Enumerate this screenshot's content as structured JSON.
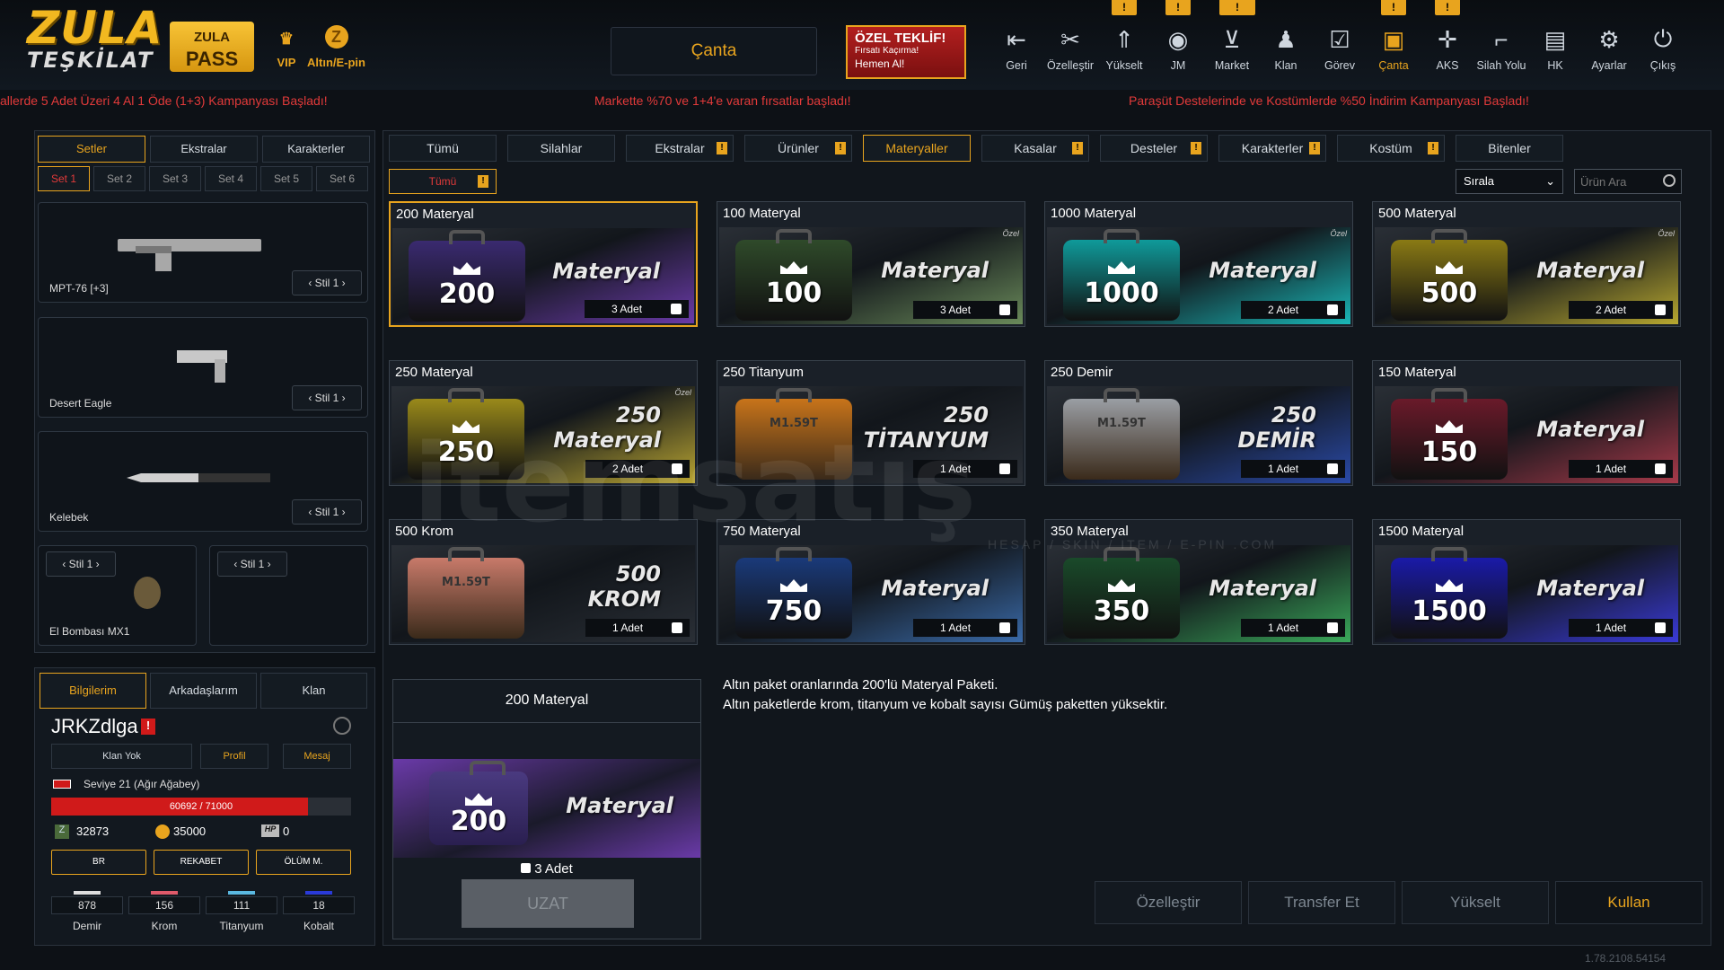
{
  "logo": {
    "line1": "ZULA",
    "line2": "TEŞKİLAT"
  },
  "pass": {
    "line1": "ZULA",
    "line2": "PASS"
  },
  "vip_label": "VIP",
  "gold_label": "Altın/E-pin",
  "canta_title": "Çanta",
  "offer": {
    "title": "ÖZEL TEKLİF!",
    "sub": "Fırsatı Kaçırma!",
    "cta": "Hemen Al!"
  },
  "nav": [
    {
      "label": "Geri",
      "icon": "back-icon"
    },
    {
      "label": "Özelleştir",
      "icon": "tools-icon"
    },
    {
      "label": "Yükselt",
      "icon": "upgrade-icon"
    },
    {
      "label": "JM",
      "icon": "coins-icon"
    },
    {
      "label": "Market",
      "icon": "cart-icon"
    },
    {
      "label": "Klan",
      "icon": "clan-icon"
    },
    {
      "label": "Görev",
      "icon": "clipboard-icon"
    },
    {
      "label": "Çanta",
      "icon": "bag-icon"
    },
    {
      "label": "AKS",
      "icon": "crosshair-icon"
    },
    {
      "label": "Silah Yolu",
      "icon": "gun-icon"
    },
    {
      "label": "HK",
      "icon": "wallet-icon"
    },
    {
      "label": "Ayarlar",
      "icon": "gear-icon"
    },
    {
      "label": "Çıkış",
      "icon": "power-icon"
    }
  ],
  "badges": {
    "mark": "!"
  },
  "ticker": [
    "allerde 5 Adet Üzeri 4 Al 1 Öde (1+3) Kampanyası Başladı!",
    "Markette %70 ve 1+4'e varan fırsatlar başladı!",
    "Paraşüt Destelerinde ve Kostümlerde %50 İndirim Kampanyası Başladı!"
  ],
  "left": {
    "tabs": [
      "Setler",
      "Ekstralar",
      "Karakterler"
    ],
    "sets": [
      "Set 1",
      "Set 2",
      "Set 3",
      "Set 4",
      "Set 5",
      "Set 6"
    ],
    "weapons": [
      "MPT-76 [+3]",
      "Desert Eagle",
      "Kelebek",
      "El Bombası MX1"
    ],
    "stil": "‹  Stil 1  ›"
  },
  "profile": {
    "tabs": [
      "Bilgilerim",
      "Arkadaşlarım",
      "Klan"
    ],
    "name": "JRKZdlga",
    "clan": "Klan Yok",
    "profil": "Profil",
    "mesaj": "Mesaj",
    "level": "Seviye 21 (Ağır Ağabey)",
    "xp": "60692 / 71000",
    "xp_progress": 0.855,
    "zula_points": "32873",
    "gold": "35000",
    "hp": "0",
    "modes": [
      "BR",
      "REKABET",
      "ÖLÜM M."
    ],
    "resources": [
      {
        "name": "Demir",
        "value": "878",
        "color": "#dddddd"
      },
      {
        "name": "Krom",
        "value": "156",
        "color": "#e05a6a"
      },
      {
        "name": "Titanyum",
        "value": "111",
        "color": "#5ab8e0"
      },
      {
        "name": "Kobalt",
        "value": "18",
        "color": "#2a3ad8"
      }
    ]
  },
  "cats": [
    "Tümü",
    "Silahlar",
    "Ekstralar",
    "Ürünler",
    "Materyaller",
    "Kasalar",
    "Desteler",
    "Karakterler",
    "Kostüm",
    "Bitenler"
  ],
  "subfilter": "Tümü",
  "sort_label": "Sırala",
  "search_placeholder": "Ürün Ara",
  "items": [
    {
      "title": "200 Materyal",
      "num": "200",
      "label": "Materyal",
      "count": "3 Adet",
      "color": "#3a2a70",
      "bg": "#6a3aa8",
      "ozel": ""
    },
    {
      "title": "100 Materyal",
      "num": "100",
      "label": "Materyal",
      "count": "3 Adet",
      "color": "#2f4a2a",
      "bg": "#6a8a5a",
      "ozel": "Özel"
    },
    {
      "title": "1000 Materyal",
      "num": "1000",
      "label": "Materyal",
      "count": "2 Adet",
      "color": "#0f9a9a",
      "bg": "#1ab8b8",
      "ozel": "Özel"
    },
    {
      "title": "500 Materyal",
      "num": "500",
      "label": "Materyal",
      "count": "2 Adet",
      "color": "#8a7a14",
      "bg": "#b8a830",
      "ozel": "Özel"
    },
    {
      "title": "250 Materyal",
      "num": "250",
      "label": "250\nMateryal",
      "count": "2 Adet",
      "color": "#9a8a1a",
      "bg": "#b8a432",
      "ozel": "Özel"
    },
    {
      "title": "250 Titanyum",
      "num": "M1.59T",
      "label": "250\nTİTANYUM",
      "count": "1 Adet",
      "color": "#c8741a",
      "bg": "#2a2f36",
      "ozel": ""
    },
    {
      "title": "250 Demir",
      "num": "M1.59T",
      "label": "250\nDEMİR",
      "count": "1 Adet",
      "color": "#9a9ea4",
      "bg": "#2a4aa8",
      "ozel": ""
    },
    {
      "title": "150 Materyal",
      "num": "150",
      "label": "Materyal",
      "count": "1 Adet",
      "color": "#6a1a2a",
      "bg": "#a83a4a",
      "ozel": ""
    },
    {
      "title": "500 Krom",
      "num": "M1.59T",
      "label": "500\nKROM",
      "count": "1 Adet",
      "color": "#c87a6a",
      "bg": "#2a2f36",
      "ozel": ""
    },
    {
      "title": "750 Materyal",
      "num": "750",
      "label": "Materyal",
      "count": "1 Adet",
      "color": "#1a3a7a",
      "bg": "#3a6aa8",
      "ozel": ""
    },
    {
      "title": "350 Materyal",
      "num": "350",
      "label": "Materyal",
      "count": "1 Adet",
      "color": "#1a4a2a",
      "bg": "#3aa85a",
      "ozel": ""
    },
    {
      "title": "1500 Materyal",
      "num": "1500",
      "label": "Materyal",
      "count": "1 Adet",
      "color": "#1a1aa8",
      "bg": "#3a3ad8",
      "ozel": ""
    }
  ],
  "detail": {
    "title": "200 Materyal",
    "num": "200",
    "label": "Materyal",
    "count": "3 Adet",
    "uzat": "UZAT",
    "desc1": "Altın paket oranlarında 200'lü Materyal Paketi.",
    "desc2": "Altın paketlerde krom, titanyum ve kobalt sayısı Gümüş paketten yüksektir."
  },
  "actions": [
    "Özelleştir",
    "Transfer Et",
    "Yükselt",
    "Kullan"
  ],
  "version": "1.78.2108.54154",
  "watermark": {
    "main": "itemsatış",
    "sub": "HESAP / SKIN / ITEM / E-PIN .COM"
  }
}
